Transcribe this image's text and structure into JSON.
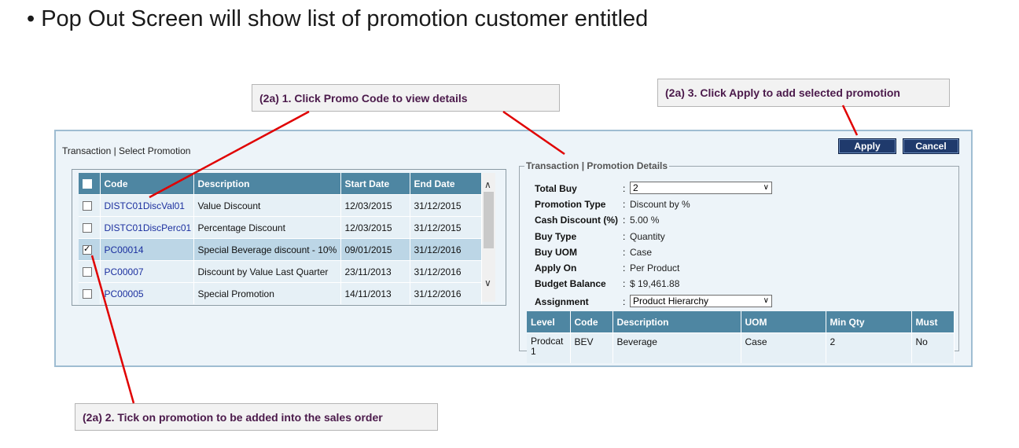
{
  "slide": {
    "title": "• Pop Out Screen will show list of promotion customer entitled"
  },
  "callouts": {
    "promo_code": "(2a) 1. Click Promo Code to view details",
    "apply": "(2a) 3. Click Apply to add selected promotion",
    "tick": "(2a) 2. Tick on promotion to be added into the sales order"
  },
  "panel": {
    "heading": "Transaction | Select Promotion",
    "apply_label": "Apply",
    "cancel_label": "Cancel"
  },
  "promotions": {
    "columns": [
      "Code",
      "Description",
      "Start Date",
      "End Date"
    ],
    "rows": [
      {
        "checked": false,
        "code": "DISTC01DiscVal01",
        "description": "Value Discount",
        "start": "12/03/2015",
        "end": "31/12/2015"
      },
      {
        "checked": false,
        "code": "DISTC01DiscPerc01",
        "description": "Percentage Discount",
        "start": "12/03/2015",
        "end": "31/12/2015"
      },
      {
        "checked": true,
        "code": "PC00014",
        "description": "Special Beverage discount - 10%",
        "start": "09/01/2015",
        "end": "31/12/2016"
      },
      {
        "checked": false,
        "code": "PC00007",
        "description": "Discount by Value Last Quarter",
        "start": "23/11/2013",
        "end": "31/12/2016"
      },
      {
        "checked": false,
        "code": "PC00005",
        "description": "Special Promotion",
        "start": "14/11/2013",
        "end": "31/12/2016"
      }
    ]
  },
  "details": {
    "legend": "Transaction | Promotion Details",
    "fields": {
      "total_buy": {
        "label": "Total Buy",
        "value": "2"
      },
      "promotion_type": {
        "label": "Promotion Type",
        "value": "Discount by %"
      },
      "cash_discount": {
        "label": "Cash Discount (%)",
        "value": "5.00  %"
      },
      "buy_type": {
        "label": "Buy Type",
        "value": "Quantity"
      },
      "buy_uom": {
        "label": "Buy UOM",
        "value": "Case"
      },
      "apply_on": {
        "label": "Apply On",
        "value": "Per Product"
      },
      "budget_balance": {
        "label": "Budget Balance",
        "value": "$ 19,461.88"
      },
      "assignment": {
        "label": "Assignment",
        "value": "Product Hierarchy"
      }
    },
    "colon": ":",
    "assignment_table": {
      "columns": [
        "Level",
        "Code",
        "Description",
        "UOM",
        "Min Qty",
        "Must"
      ],
      "rows": [
        {
          "level": "Prodcat 1",
          "code": "BEV",
          "description": "Beverage",
          "uom": "Case",
          "min_qty": "2",
          "must": "No"
        }
      ]
    }
  },
  "colors": {
    "header": "#4e86a2",
    "button": "#1f3a6c",
    "callout_text": "#4b1a4b",
    "pointer": "#e00000",
    "link": "#1b2f9f"
  }
}
